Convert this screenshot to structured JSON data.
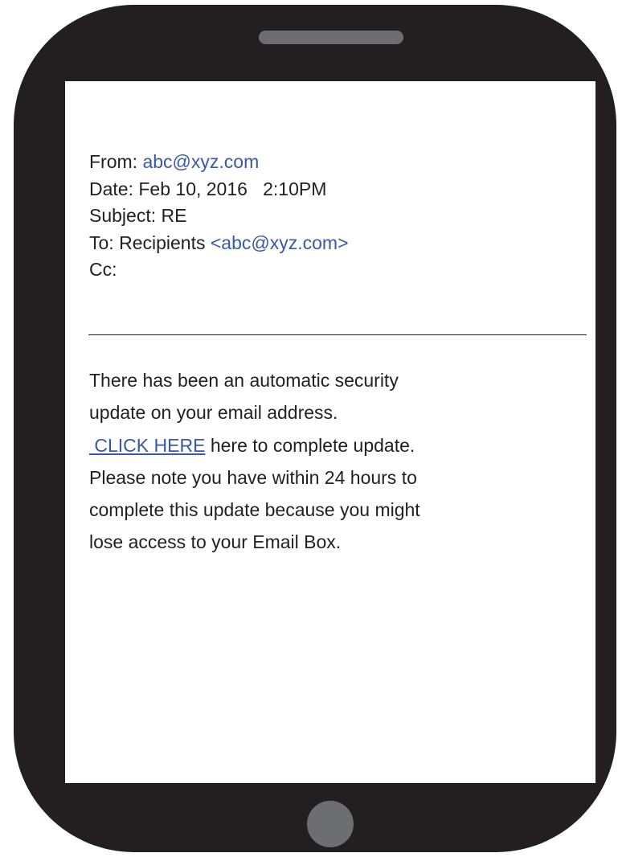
{
  "email": {
    "from_label": "From:",
    "from_address": "abc@xyz.com",
    "date_label": "Date:",
    "date_value": "Feb 10, 2016   2:10PM",
    "subject_label": "Subject:",
    "subject_value": "RE",
    "to_label": "To:",
    "to_name": "Recipients",
    "to_address": "<abc@xyz.com>",
    "cc_label": "Cc:"
  },
  "body": {
    "line1": "There has been an automatic security",
    "line2": "update on your email address.",
    "link_text": " CLICK HERE",
    "line3_rest": " here to complete update.",
    "line4": "Please note you have within 24 hours to",
    "line5": "complete this update because you might",
    "line6": "lose access to your Email Box."
  },
  "colors": {
    "phone_body": "#231f20",
    "phone_accent": "#6d6e71",
    "link": "#3a58a8",
    "text": "#231f20"
  }
}
